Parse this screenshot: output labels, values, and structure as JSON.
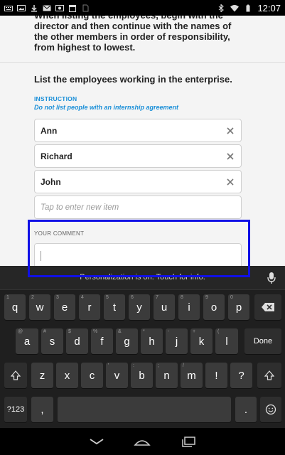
{
  "status_bar": {
    "time": "12:07",
    "left_icons": [
      "keyboard-icon",
      "image-icon",
      "download-icon",
      "gmail-icon",
      "photo-icon",
      "calendar-icon",
      "sim-icon"
    ],
    "right_icons": [
      "bluetooth-icon",
      "wifi-icon",
      "battery-icon"
    ]
  },
  "previous_question": {
    "text": "When listing the employees, begin with the director and then continue with the names of the other members in order of responsibility, from highest to lowest."
  },
  "question": {
    "title": "List the employees working in the enterprise.",
    "instruction_label": "INSTRUCTION",
    "instruction_text": "Do not list people with an internship agreement",
    "items": [
      {
        "value": "Ann"
      },
      {
        "value": "Richard"
      },
      {
        "value": "John"
      }
    ],
    "new_item_placeholder": "Tap to enter new item"
  },
  "comment": {
    "label": "YOUR COMMENT",
    "value": ""
  },
  "keyboard": {
    "suggestion_text": "Personalization is on. Touch for info.",
    "row1": [
      {
        "key": "q",
        "hint": "1"
      },
      {
        "key": "w",
        "hint": "2"
      },
      {
        "key": "e",
        "hint": "3"
      },
      {
        "key": "r",
        "hint": "4"
      },
      {
        "key": "t",
        "hint": "5"
      },
      {
        "key": "y",
        "hint": "6"
      },
      {
        "key": "u",
        "hint": "7"
      },
      {
        "key": "i",
        "hint": "8"
      },
      {
        "key": "o",
        "hint": "9"
      },
      {
        "key": "p",
        "hint": "0"
      }
    ],
    "row2": [
      {
        "key": "a",
        "hint": "@"
      },
      {
        "key": "s",
        "hint": "#"
      },
      {
        "key": "d",
        "hint": "$"
      },
      {
        "key": "f",
        "hint": "%"
      },
      {
        "key": "g",
        "hint": "&"
      },
      {
        "key": "h",
        "hint": "*"
      },
      {
        "key": "j",
        "hint": "-"
      },
      {
        "key": "k",
        "hint": "+"
      },
      {
        "key": "l",
        "hint": "("
      }
    ],
    "row3": [
      {
        "key": "z",
        "hint": ""
      },
      {
        "key": "x",
        "hint": ""
      },
      {
        "key": "c",
        "hint": ""
      },
      {
        "key": "v",
        "hint": "'"
      },
      {
        "key": "b",
        "hint": ":"
      },
      {
        "key": "n",
        "hint": ";"
      },
      {
        "key": "m",
        "hint": "/"
      },
      {
        "key": "!",
        "hint": ""
      },
      {
        "key": "?",
        "hint": ""
      }
    ],
    "done_label": "Done",
    "symbols_label": "?123",
    "comma_label": ",",
    "period_label": "."
  },
  "colors": {
    "accent": "#1a8fd8",
    "highlight": "#1010e6",
    "keyboard_bg": "#1f1f1f",
    "key_bg": "#3b3b3b"
  }
}
